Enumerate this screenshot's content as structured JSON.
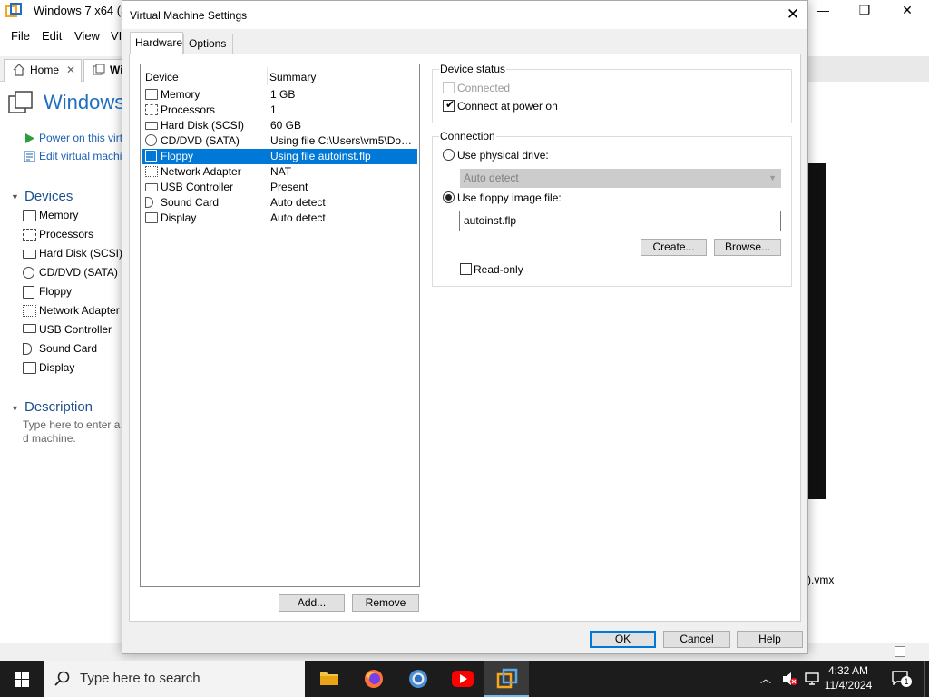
{
  "background": {
    "window_title": "Windows 7 x64 (3)",
    "menu": [
      "File",
      "Edit",
      "View",
      "VI"
    ],
    "tabs": [
      {
        "label": "Home"
      },
      {
        "label": "Wi"
      }
    ],
    "vm_title": "Windows",
    "actions": [
      "Power on this virt",
      "Edit virtual machi"
    ],
    "devices_heading": "Devices",
    "devices": [
      "Memory",
      "Processors",
      "Hard Disk (SCSI)",
      "CD/DVD (SATA)",
      "Floppy",
      "Network Adapter",
      "USB Controller",
      "Sound Card",
      "Display"
    ],
    "description_heading": "Description",
    "description_placeholder": "Type here to enter a d machine.",
    "vmx_fragment": ").vmx"
  },
  "dialog": {
    "title": "Virtual Machine Settings",
    "tabs": [
      "Hardware",
      "Options"
    ],
    "list_headers": {
      "device": "Device",
      "summary": "Summary"
    },
    "devices": [
      {
        "icon": "memory-icon",
        "name": "Memory",
        "summary": "1 GB"
      },
      {
        "icon": "processor-icon",
        "name": "Processors",
        "summary": "1"
      },
      {
        "icon": "hard-disk-icon",
        "name": "Hard Disk (SCSI)",
        "summary": "60 GB"
      },
      {
        "icon": "cd-dvd-icon",
        "name": "CD/DVD (SATA)",
        "summary": "Using file C:\\Users\\vm5\\Down..."
      },
      {
        "icon": "floppy-icon",
        "name": "Floppy",
        "summary": "Using file autoinst.flp",
        "selected": true
      },
      {
        "icon": "network-icon",
        "name": "Network Adapter",
        "summary": "NAT"
      },
      {
        "icon": "usb-icon",
        "name": "USB Controller",
        "summary": "Present"
      },
      {
        "icon": "sound-icon",
        "name": "Sound Card",
        "summary": "Auto detect"
      },
      {
        "icon": "display-icon",
        "name": "Display",
        "summary": "Auto detect"
      }
    ],
    "add_label": "Add...",
    "remove_label": "Remove",
    "device_status": {
      "legend": "Device status",
      "connected": "Connected",
      "connected_checked": false,
      "connect_at_power_on": "Connect at power on",
      "connect_at_power_on_checked": true
    },
    "connection": {
      "legend": "Connection",
      "physical_drive": "Use physical drive:",
      "physical_drive_value": "Auto detect",
      "floppy_image": "Use floppy image file:",
      "floppy_image_value": "autoinst.flp",
      "create_label": "Create...",
      "browse_label": "Browse...",
      "read_only": "Read-only",
      "selected": "floppy_image"
    },
    "ok_label": "OK",
    "cancel_label": "Cancel",
    "help_label": "Help"
  },
  "taskbar": {
    "search_placeholder": "Type here to search",
    "time": "4:32 AM",
    "date": "11/4/2024",
    "notification_count": "1"
  },
  "colors": {
    "selection": "#0078d7",
    "accent_link": "#1a5fb4",
    "taskbar": "#1c1c1c"
  }
}
